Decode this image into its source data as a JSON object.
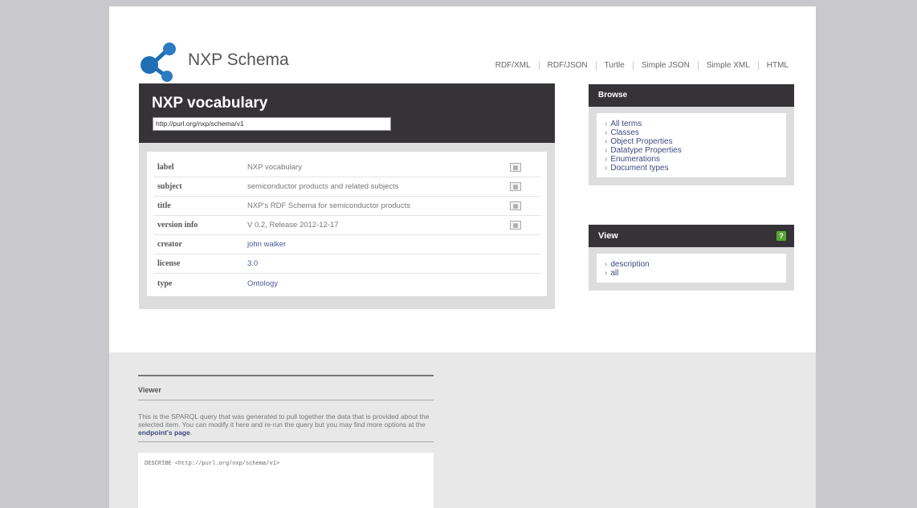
{
  "site": {
    "title": "NXP Schema"
  },
  "formats": [
    "RDF/XML",
    "RDF/JSON",
    "Turtle",
    "Simple JSON",
    "Simple XML",
    "HTML"
  ],
  "resource": {
    "title": "NXP vocabulary",
    "uri": "http://purl.org/nxp/schema/v1",
    "properties": [
      {
        "key": "label",
        "value": "NXP vocabulary",
        "link": false,
        "lang_flag": true
      },
      {
        "key": "subject",
        "value": "semiconductor products and related subjects",
        "link": false,
        "lang_flag": true
      },
      {
        "key": "title",
        "value": "NXP's RDF Schema for semiconductor products",
        "link": false,
        "lang_flag": true
      },
      {
        "key": "version info",
        "value": "V 0.2, Release 2012-12-17",
        "link": false,
        "lang_flag": true
      },
      {
        "key": "creator",
        "value": "john walker",
        "link": true,
        "lang_flag": false
      },
      {
        "key": "license",
        "value": "3.0",
        "link": true,
        "lang_flag": false
      },
      {
        "key": "type",
        "value": "Ontology",
        "link": true,
        "lang_flag": false
      }
    ]
  },
  "browse": {
    "heading": "Browse",
    "items": [
      "All terms",
      "Classes",
      "Object Properties",
      "Datatype Properties",
      "Enumerations",
      "Document types"
    ]
  },
  "view": {
    "heading": "View",
    "help": "?",
    "items": [
      "description",
      "all"
    ]
  },
  "viewer": {
    "heading": "Viewer",
    "text_before": "This is the SPARQL query that was generated to pull together the data that is provided about the selected item. You can modify it here and re-run the query but you may find more options at the ",
    "link": "endpoint's page",
    "text_after": ".",
    "query": "DESCRIBE <http://purl.org/nxp/schema/v1>"
  },
  "icons": {
    "list_arrow": "›",
    "lang_flag": "flag-icon"
  },
  "colors": {
    "header_dark": "#363338",
    "panel_grey": "#dddddd",
    "link_blue": "#3d4a80",
    "help_green": "#55a630"
  }
}
